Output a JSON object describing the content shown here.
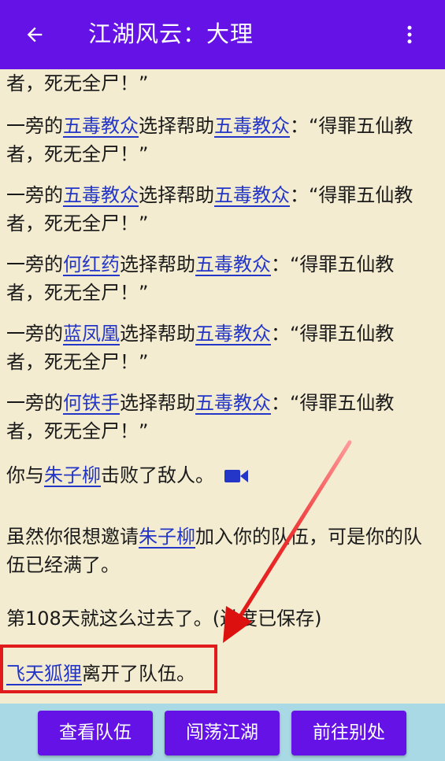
{
  "appbar": {
    "title": "江湖风云：大理",
    "back_icon": "arrow-left-icon",
    "menu_icon": "more-vert-icon"
  },
  "log": [
    {
      "parts": [
        {
          "text": "者，死无全尸！”"
        }
      ]
    },
    {
      "parts": [
        {
          "text": "一旁的"
        },
        {
          "text": "五毒教众",
          "link": true
        },
        {
          "text": "选择帮助"
        },
        {
          "text": "五毒教众",
          "link": true
        },
        {
          "text": "：“得罪五仙教者，死无全尸！”"
        }
      ]
    },
    {
      "parts": [
        {
          "text": "一旁的"
        },
        {
          "text": "五毒教众",
          "link": true
        },
        {
          "text": "选择帮助"
        },
        {
          "text": "五毒教众",
          "link": true
        },
        {
          "text": "：“得罪五仙教者，死无全尸！”"
        }
      ]
    },
    {
      "parts": [
        {
          "text": "一旁的"
        },
        {
          "text": "何红药",
          "link": true
        },
        {
          "text": "选择帮助"
        },
        {
          "text": "五毒教众",
          "link": true
        },
        {
          "text": "：“得罪五仙教者，死无全尸！”"
        }
      ]
    },
    {
      "parts": [
        {
          "text": "一旁的"
        },
        {
          "text": "蓝凤凰",
          "link": true
        },
        {
          "text": "选择帮助"
        },
        {
          "text": "五毒教众",
          "link": true
        },
        {
          "text": "：“得罪五仙教者，死无全尸！”"
        }
      ]
    },
    {
      "parts": [
        {
          "text": "一旁的"
        },
        {
          "text": "何铁手",
          "link": true
        },
        {
          "text": "选择帮助"
        },
        {
          "text": "五毒教众",
          "link": true
        },
        {
          "text": "：“得罪五仙教者，死无全尸！”"
        }
      ]
    },
    {
      "parts": [
        {
          "text": "你与"
        },
        {
          "text": "朱子柳",
          "link": true
        },
        {
          "text": "击败了敌人。"
        }
      ],
      "icon": "video-camera-icon"
    },
    {
      "parts": [
        {
          "text": "虽然你很想邀请"
        },
        {
          "text": "朱子柳",
          "link": true
        },
        {
          "text": "加入你的队伍，可是你的队伍已经满了。"
        }
      ]
    },
    {
      "parts": [
        {
          "text": "第108天就这么过去了。(进度已保存)"
        }
      ]
    },
    {
      "parts": [
        {
          "text": "飞天狐狸",
          "link": true
        },
        {
          "text": "离开了队伍。"
        }
      ]
    }
  ],
  "colors": {
    "primary": "#6412e6",
    "background": "#f3ecd1",
    "link": "#2436c8",
    "bottom_bar": "#a9d9e4",
    "annotation": "#e11b1b"
  },
  "buttons": [
    {
      "label": "查看队伍"
    },
    {
      "label": "闯荡江湖"
    },
    {
      "label": "前往别处"
    }
  ]
}
